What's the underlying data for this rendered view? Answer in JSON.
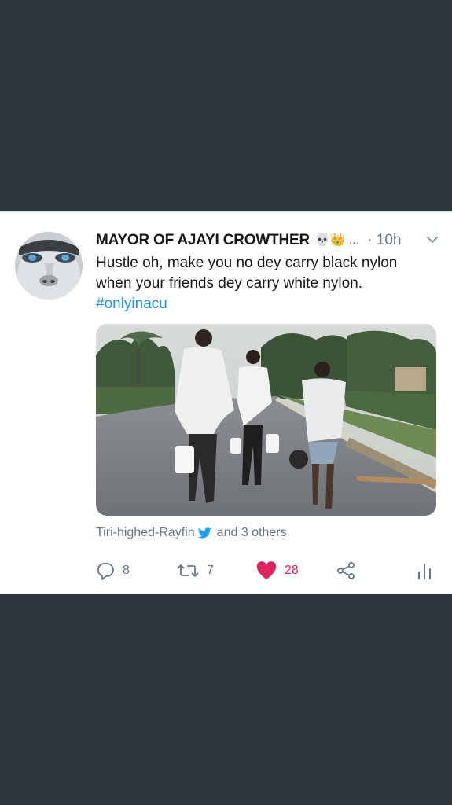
{
  "tweet": {
    "author_name": "MAYOR OF AJAYI CROWTHER",
    "emojis": "💀👑",
    "ellipsis": "...",
    "timestamp": "· 10h",
    "text_line1": "Hustle oh, make you no dey carry black nylon",
    "text_line2": "when your friends dey carry white nylon.",
    "hashtag": "#onlyinacu",
    "liked_by_name": "Tiri-highed-Rayfin",
    "liked_by_others": "and 3 others"
  },
  "actions": {
    "reply_count": "8",
    "retweet_count": "7",
    "like_count": "28"
  },
  "colors": {
    "background": "#2b363d",
    "card": "#ffffff",
    "link": "#1b95e0",
    "like": "#e0245e",
    "muted": "#657786"
  },
  "icons": [
    "chevron-down-icon",
    "reply-icon",
    "retweet-icon",
    "heart-icon",
    "share-icon",
    "analytics-icon",
    "bird-icon"
  ]
}
